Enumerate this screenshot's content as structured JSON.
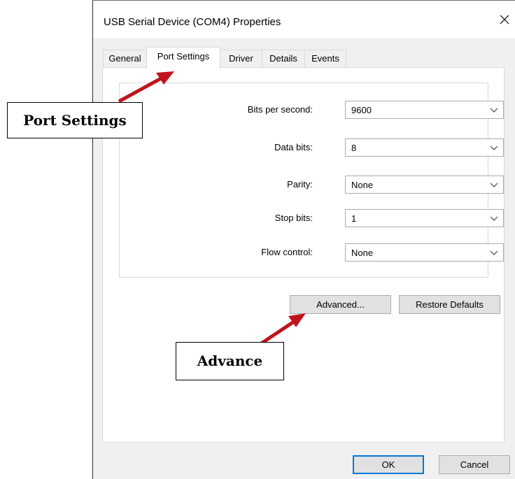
{
  "window": {
    "title": "USB Serial Device (COM4) Properties"
  },
  "tabs": [
    {
      "label": "General",
      "active": false
    },
    {
      "label": "Port Settings",
      "active": true
    },
    {
      "label": "Driver",
      "active": false
    },
    {
      "label": "Details",
      "active": false
    },
    {
      "label": "Events",
      "active": false
    }
  ],
  "port_settings": {
    "fields": [
      {
        "label": "Bits per second:",
        "value": "9600"
      },
      {
        "label": "Data bits:",
        "value": "8"
      },
      {
        "label": "Parity:",
        "value": "None"
      },
      {
        "label": "Stop bits:",
        "value": "1"
      },
      {
        "label": "Flow control:",
        "value": "None"
      }
    ],
    "advanced_label": "Advanced...",
    "restore_label": "Restore Defaults"
  },
  "footer": {
    "ok_label": "OK",
    "cancel_label": "Cancel"
  },
  "annotations": {
    "port_settings_callout": "Port Settings",
    "advance_callout": "Advance",
    "arrow_color": "#c0141c"
  },
  "icons": {
    "close": "close-icon",
    "dropdown": "chevron-down-icon"
  }
}
